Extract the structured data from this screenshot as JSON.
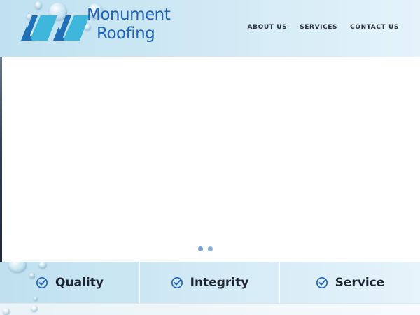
{
  "brand": {
    "line1": "Monument",
    "line2": "Roofing",
    "colors": {
      "text": "#1f63b8",
      "mark_light": "#3fb6dc",
      "mark_dark": "#1e6fb8"
    }
  },
  "nav": {
    "items": [
      {
        "label": "ABOUT US"
      },
      {
        "label": "SERVICES"
      },
      {
        "label": "CONTACT US"
      }
    ]
  },
  "hero": {
    "slider": {
      "slides": 2,
      "active": 1
    }
  },
  "features": [
    {
      "label": "Quality",
      "icon": "check-circle-icon"
    },
    {
      "label": "Integrity",
      "icon": "check-circle-icon"
    },
    {
      "label": "Service",
      "icon": "check-circle-icon"
    }
  ]
}
